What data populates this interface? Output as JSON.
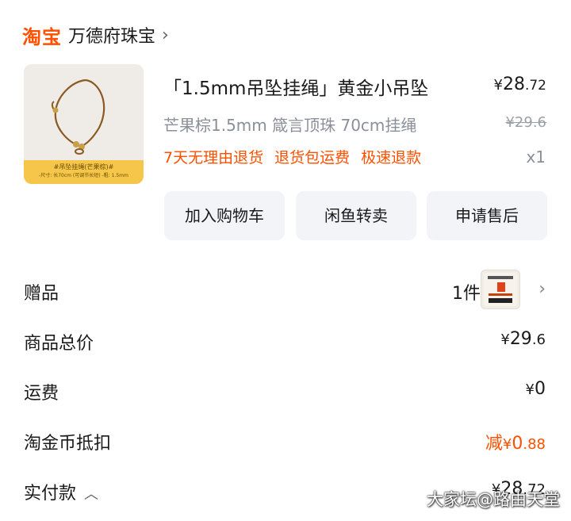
{
  "header": {
    "brand": "淘宝",
    "shop_name": "万德府珠宝",
    "chevron": "›"
  },
  "product": {
    "title": "「1.5mm吊坠挂绳」黄金小吊坠",
    "price_currency": "¥",
    "price_int": "28",
    "price_dec": ".72",
    "spec": "芒果棕1.5mm 箴言顶珠 70cm挂绳",
    "original_price": "¥29.6",
    "tags": [
      "7天无理由退货",
      "退货包运费",
      "极速退款"
    ],
    "quantity": "x1",
    "image_caption": "#吊坠挂绳(芒果棕)#",
    "image_sub": "-尺寸: 长70cm (可调节长短) -粗: 1.5mm"
  },
  "actions": {
    "add_to_cart": "加入购物车",
    "resell": "闲鱼转卖",
    "after_sale": "申请售后"
  },
  "summary": {
    "gift": {
      "label": "赠品",
      "count": "1件"
    },
    "total": {
      "label": "商品总价",
      "currency": "¥",
      "int": "29",
      "dec": ".6"
    },
    "shipping": {
      "label": "运费",
      "currency": "¥",
      "int": "0"
    },
    "coin_deduct": {
      "label": "淘金币抵扣",
      "prefix": "减",
      "currency": "¥",
      "int": "0",
      "dec": ".88"
    },
    "paid": {
      "label": "实付款",
      "currency": "¥",
      "int": "28",
      "dec": ".72",
      "caret": "︿"
    }
  },
  "watermark": "大家坛@路由天堂",
  "colors": {
    "accent": "#ff5000",
    "muted": "#8a8f99",
    "button_bg": "#f2f4f7"
  }
}
